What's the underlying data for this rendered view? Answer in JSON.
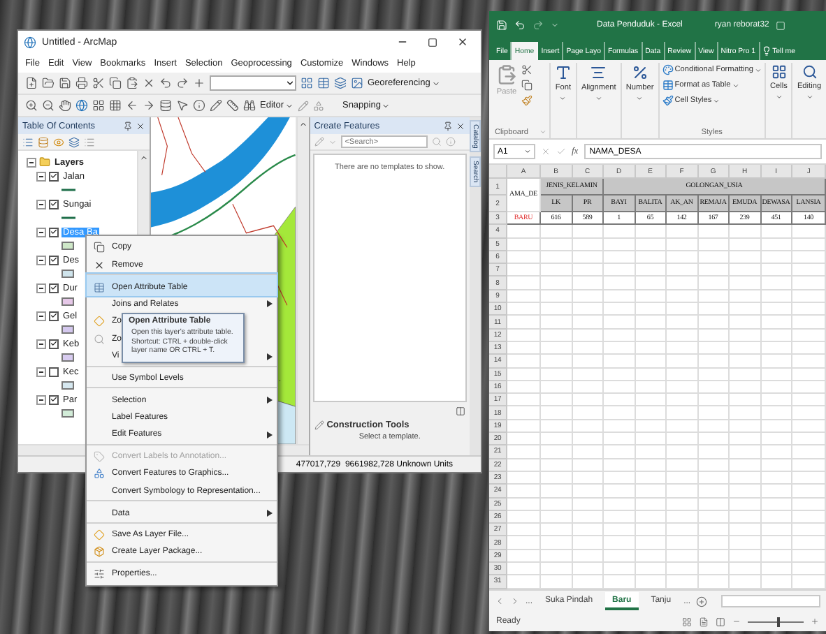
{
  "arcmap": {
    "title": "Untitled - ArcMap",
    "menu": [
      "File",
      "Edit",
      "View",
      "Bookmarks",
      "Insert",
      "Selection",
      "Geoprocessing",
      "Customize",
      "Windows",
      "Help"
    ],
    "toolbar_menus": [
      "Georeferencing",
      "Editor",
      "Snapping"
    ],
    "toc": {
      "title": "Table Of Contents",
      "root_label": "Layers",
      "root_expanded": true,
      "layers": [
        {
          "label": "Jalan",
          "checked": true,
          "expanded": true,
          "selected": false,
          "kind": "line",
          "color": "#1f6f4a"
        },
        {
          "label": "Sungai",
          "checked": true,
          "expanded": true,
          "selected": false,
          "kind": "line",
          "color": "#1f6f4a"
        },
        {
          "label": "Desa Ba",
          "checked": true,
          "expanded": true,
          "selected": true,
          "kind": "fill",
          "color": "#cfe8c8"
        },
        {
          "label": "Des",
          "checked": true,
          "expanded": true,
          "selected": false,
          "kind": "fill",
          "color": "#cfe4ec"
        },
        {
          "label": "Dur",
          "checked": true,
          "expanded": true,
          "selected": false,
          "kind": "fill",
          "color": "#e6c8e8"
        },
        {
          "label": "Gel",
          "checked": true,
          "expanded": true,
          "selected": false,
          "kind": "fill",
          "color": "#d4c8ee"
        },
        {
          "label": "Keb",
          "checked": true,
          "expanded": true,
          "selected": false,
          "kind": "fill",
          "color": "#d8ccf0"
        },
        {
          "label": "Kec",
          "checked": false,
          "expanded": true,
          "selected": false,
          "kind": "fill",
          "color": "#d6e8f0"
        },
        {
          "label": "Par",
          "checked": true,
          "expanded": true,
          "selected": false,
          "kind": "fill",
          "color": "#d2ecd8"
        }
      ]
    },
    "create_features": {
      "title": "Create Features",
      "search_placeholder": "<Search>",
      "empty_message": "There are no templates to show.",
      "tools_title": "Construction Tools",
      "tools_message": "Select a template."
    },
    "side_tabs": [
      "Catalog",
      "Search"
    ],
    "status": "477017,729  9661982,728 Unknown Units"
  },
  "context_menu": {
    "items": [
      {
        "label": "Copy",
        "disabled": false,
        "selected": false,
        "submenu": false,
        "separator_before": false
      },
      {
        "label": "Remove",
        "disabled": false,
        "selected": false,
        "submenu": false,
        "separator_before": false
      },
      {
        "label": "Open Attribute Table",
        "disabled": false,
        "selected": true,
        "submenu": false,
        "separator_before": true
      },
      {
        "label": "Joins and Relates",
        "disabled": false,
        "selected": false,
        "submenu": true,
        "separator_before": false
      },
      {
        "label": "Zo",
        "disabled": false,
        "selected": false,
        "submenu": false,
        "separator_before": false
      },
      {
        "label": "Zo",
        "disabled": false,
        "selected": false,
        "submenu": false,
        "separator_before": false
      },
      {
        "label": "Vi",
        "disabled": false,
        "selected": false,
        "submenu": true,
        "separator_before": false
      },
      {
        "label": "Use Symbol Levels",
        "disabled": false,
        "selected": false,
        "submenu": false,
        "separator_before": true
      },
      {
        "label": "Selection",
        "disabled": false,
        "selected": false,
        "submenu": true,
        "separator_before": true
      },
      {
        "label": "Label Features",
        "disabled": false,
        "selected": false,
        "submenu": false,
        "separator_before": false
      },
      {
        "label": "Edit Features",
        "disabled": false,
        "selected": false,
        "submenu": true,
        "separator_before": false
      },
      {
        "label": "Convert Labels to Annotation...",
        "disabled": true,
        "selected": false,
        "submenu": false,
        "separator_before": true
      },
      {
        "label": "Convert Features to Graphics...",
        "disabled": false,
        "selected": false,
        "submenu": false,
        "separator_before": false
      },
      {
        "label": "Convert Symbology to Representation...",
        "disabled": false,
        "selected": false,
        "submenu": false,
        "separator_before": false
      },
      {
        "label": "Data",
        "disabled": false,
        "selected": false,
        "submenu": true,
        "separator_before": true
      },
      {
        "label": "Save As Layer File...",
        "disabled": false,
        "selected": false,
        "submenu": false,
        "separator_before": true
      },
      {
        "label": "Create Layer Package...",
        "disabled": false,
        "selected": false,
        "submenu": false,
        "separator_before": false
      },
      {
        "label": "Properties...",
        "disabled": false,
        "selected": false,
        "submenu": false,
        "separator_before": true
      }
    ]
  },
  "tooltip": {
    "title": "Open Attribute Table",
    "text": "Open this layer's attribute table. Shortcut: CTRL + double-click layer name OR CTRL + T."
  },
  "excel": {
    "title": "Data Penduduk - Excel",
    "user": "ryan reborat32",
    "tabs": [
      {
        "label": "File",
        "selected": false
      },
      {
        "label": "Home",
        "selected": true
      },
      {
        "label": "Insert",
        "selected": false
      },
      {
        "label": "Page Layo",
        "selected": false
      },
      {
        "label": "Formulas",
        "selected": false
      },
      {
        "label": "Data",
        "selected": false
      },
      {
        "label": "Review",
        "selected": false
      },
      {
        "label": "View",
        "selected": false
      },
      {
        "label": "Nitro Pro 1",
        "selected": false
      }
    ],
    "tell_me": "Tell me",
    "ribbon": {
      "paste": "Paste",
      "collapsed_groups": [
        "Font",
        "Alignment",
        "Number"
      ],
      "styles": [
        "Conditional Formatting",
        "Format as Table",
        "Cell Styles"
      ],
      "right_groups": [
        "Cells",
        "Editing"
      ],
      "clipboard_label": "Clipboard",
      "styles_label": "Styles"
    },
    "name_box": "A1",
    "function_label": "fx",
    "formula": "NAMA_DESA",
    "columns": [
      "A",
      "B",
      "C",
      "D",
      "E",
      "F",
      "G",
      "H",
      "I",
      "J"
    ],
    "row_numbers": [
      "1",
      "2",
      "3",
      "4",
      "5",
      "6",
      "7",
      "8",
      "9",
      "10",
      "11",
      "12",
      "13",
      "14",
      "15",
      "16",
      "17",
      "18",
      "19",
      "20",
      "21",
      "22",
      "23",
      "24",
      "25",
      "26",
      "27",
      "28",
      "29",
      "30",
      "31"
    ],
    "table": {
      "name_header": "AMA_DE",
      "groups": [
        {
          "label": "JENIS_KELAMIN",
          "columns": [
            "LK",
            "PR"
          ]
        },
        {
          "label": "GOLONGAN_USIA",
          "columns": [
            "BAYI",
            "BALITA",
            "AK_AN",
            "REMAJA",
            "EMUDA",
            "DEWASA",
            "LANSIA"
          ]
        }
      ],
      "rows": [
        [
          "BARU",
          "616",
          "589",
          "1",
          "65",
          "142",
          "167",
          "239",
          "451",
          "140"
        ]
      ]
    },
    "sheet_more_left": "...",
    "sheets": [
      {
        "label": "Suka Pindah",
        "selected": false
      },
      {
        "label": "Baru",
        "selected": true
      },
      {
        "label": "Tanju",
        "selected": false
      }
    ],
    "sheet_more_right": "...",
    "status": "Ready",
    "zoom": {
      "level": 0.55
    }
  }
}
